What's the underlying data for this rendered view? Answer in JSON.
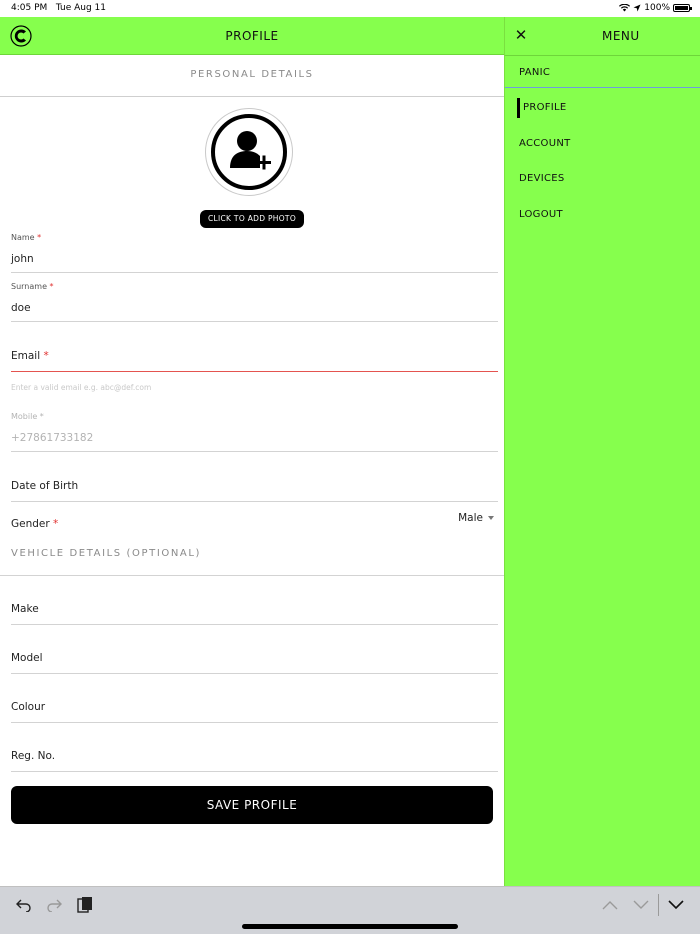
{
  "status_bar": {
    "time": "4:05 PM",
    "date": "Tue Aug 11",
    "battery": "100%"
  },
  "header": {
    "title": "PROFILE",
    "logo_icon": "brand-logo-icon"
  },
  "personal": {
    "title": "PERSONAL DETAILS",
    "add_photo_label": "CLICK TO ADD PHOTO",
    "name": {
      "label": "Name",
      "value": "john"
    },
    "surname": {
      "label": "Surname",
      "value": "doe"
    },
    "email": {
      "label": "Email",
      "hint": "Enter a valid email e.g. abc@def.com"
    },
    "mobile": {
      "label": "Mobile",
      "value": "+27861733182"
    },
    "dob": {
      "label": "Date of Birth"
    },
    "gender": {
      "label": "Gender",
      "value": "Male"
    },
    "required_mark": "*"
  },
  "vehicle": {
    "title": "VEHICLE DETAILS (OPTIONAL)",
    "make": {
      "label": "Make"
    },
    "model": {
      "label": "Model"
    },
    "colour": {
      "label": "Colour"
    },
    "reg": {
      "label": "Reg. No."
    }
  },
  "save_label": "SAVE PROFILE",
  "menu": {
    "title": "MENU",
    "items": [
      {
        "label": "PANIC"
      },
      {
        "label": "PROFILE"
      },
      {
        "label": "ACCOUNT"
      },
      {
        "label": "DEVICES"
      },
      {
        "label": "LOGOUT"
      }
    ],
    "active": "PROFILE"
  },
  "colors": {
    "accent": "#86ff4d",
    "error": "#e4534f",
    "dark": "#000000"
  }
}
